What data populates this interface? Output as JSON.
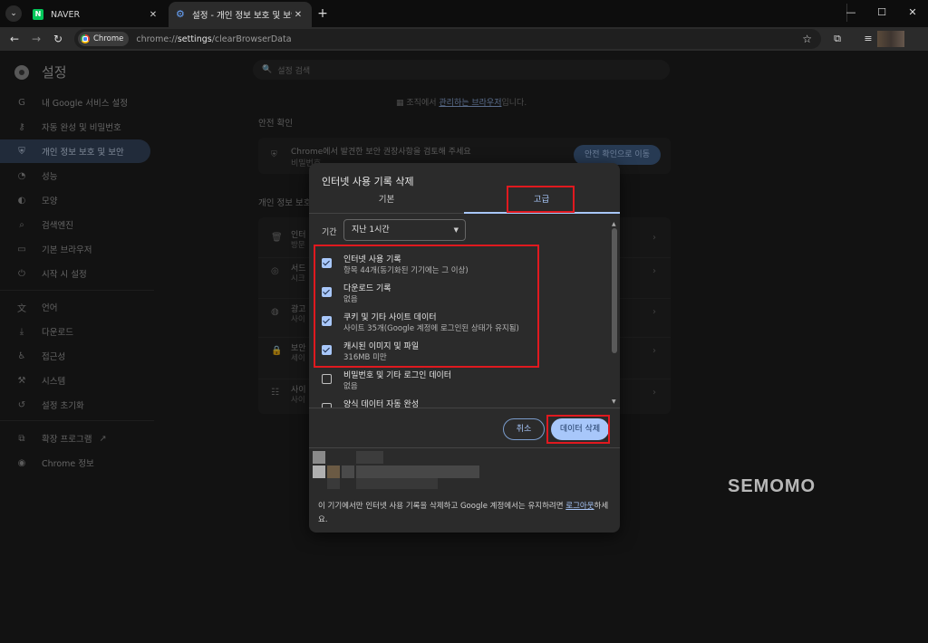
{
  "tabs": [
    {
      "title": "NAVER",
      "favicon": "naver-icon",
      "active": false
    },
    {
      "title": "설정 - 개인 정보 보호 및 보안",
      "favicon": "gear-icon",
      "active": true
    }
  ],
  "address_bar": {
    "chip_label": "Chrome",
    "url_prefix": "chrome://",
    "url_highlight": "settings",
    "url_suffix": "/clearBrowserData"
  },
  "settings": {
    "title": "설정",
    "search_placeholder": "설정 검색",
    "sidebar": [
      {
        "label": "내 Google 서비스 설정",
        "icon": "google-icon"
      },
      {
        "label": "자동 완성 및 비밀번호",
        "icon": "key-icon"
      },
      {
        "label": "개인 정보 보호 및 보안",
        "icon": "shield-icon",
        "active": true
      },
      {
        "label": "성능",
        "icon": "speedometer-icon"
      },
      {
        "label": "모양",
        "icon": "palette-icon"
      },
      {
        "label": "검색엔진",
        "icon": "search-icon"
      },
      {
        "label": "기본 브라우저",
        "icon": "browser-icon"
      },
      {
        "label": "시작 시 설정",
        "icon": "power-icon"
      },
      {
        "label": "언어",
        "icon": "translate-icon"
      },
      {
        "label": "다운로드",
        "icon": "download-icon"
      },
      {
        "label": "접근성",
        "icon": "accessibility-icon"
      },
      {
        "label": "시스템",
        "icon": "wrench-icon"
      },
      {
        "label": "설정 초기화",
        "icon": "reset-icon"
      },
      {
        "label": "확장 프로그램",
        "icon": "puzzle-icon"
      },
      {
        "label": "Chrome 정보",
        "icon": "chrome-icon"
      }
    ],
    "managed_prefix": "조직에서",
    "managed_link": "관리하는 브라우저",
    "managed_suffix": "입니다.",
    "safety_title": "안전 확인",
    "safety_text1": "Chrome에서 발견한 보안 권장사항을 검토해 주세요",
    "safety_text2": "비밀번호",
    "safety_button": "안전 확인으로 이동",
    "privacy_title": "개인 정보 보호",
    "privacy_rows": [
      {
        "t1": "인터",
        "t2": "방문"
      },
      {
        "t1": "서드",
        "t2": "시크"
      },
      {
        "t1": "광고",
        "t2": "사이"
      },
      {
        "t1": "보안",
        "t2": "세이"
      },
      {
        "t1": "사이",
        "t2": "사이"
      }
    ]
  },
  "dialog": {
    "title": "인터넷 사용 기록 삭제",
    "tab_basic": "기본",
    "tab_advanced": "고급",
    "period_label": "기간",
    "period_value": "지난 1시간",
    "options": [
      {
        "title": "인터넷 사용 기록",
        "detail": "항목 44개(동기화된 기기에는 그 이상)",
        "checked": true
      },
      {
        "title": "다운로드 기록",
        "detail": "없음",
        "checked": true
      },
      {
        "title": "쿠키 및 기타 사이트 데이터",
        "detail": "사이트 35개(Google 계정에 로그인된 상태가 유지됨)",
        "checked": true
      },
      {
        "title": "캐시된 이미지 및 파일",
        "detail": "316MB 미만",
        "checked": true
      },
      {
        "title": "비밀번호 및 기타 로그인 데이터",
        "detail": "없음",
        "checked": false
      },
      {
        "title": "양식 데이터 자동 완성",
        "detail": "",
        "checked": false
      }
    ],
    "cancel_label": "취소",
    "delete_label": "데이터 삭제",
    "footer_text": "이 기기에서만 인터넷 사용 기록을 삭제하고 Google 계정에서는 유지하려면",
    "footer_link": "로그아웃",
    "footer_suffix": "하세요."
  },
  "watermark": "SEMOMO",
  "colors": {
    "accent": "#a8c7fa",
    "highlight_box": "#e0191f",
    "naver_green": "#03c75a",
    "sidebar_active": "#34435a"
  }
}
